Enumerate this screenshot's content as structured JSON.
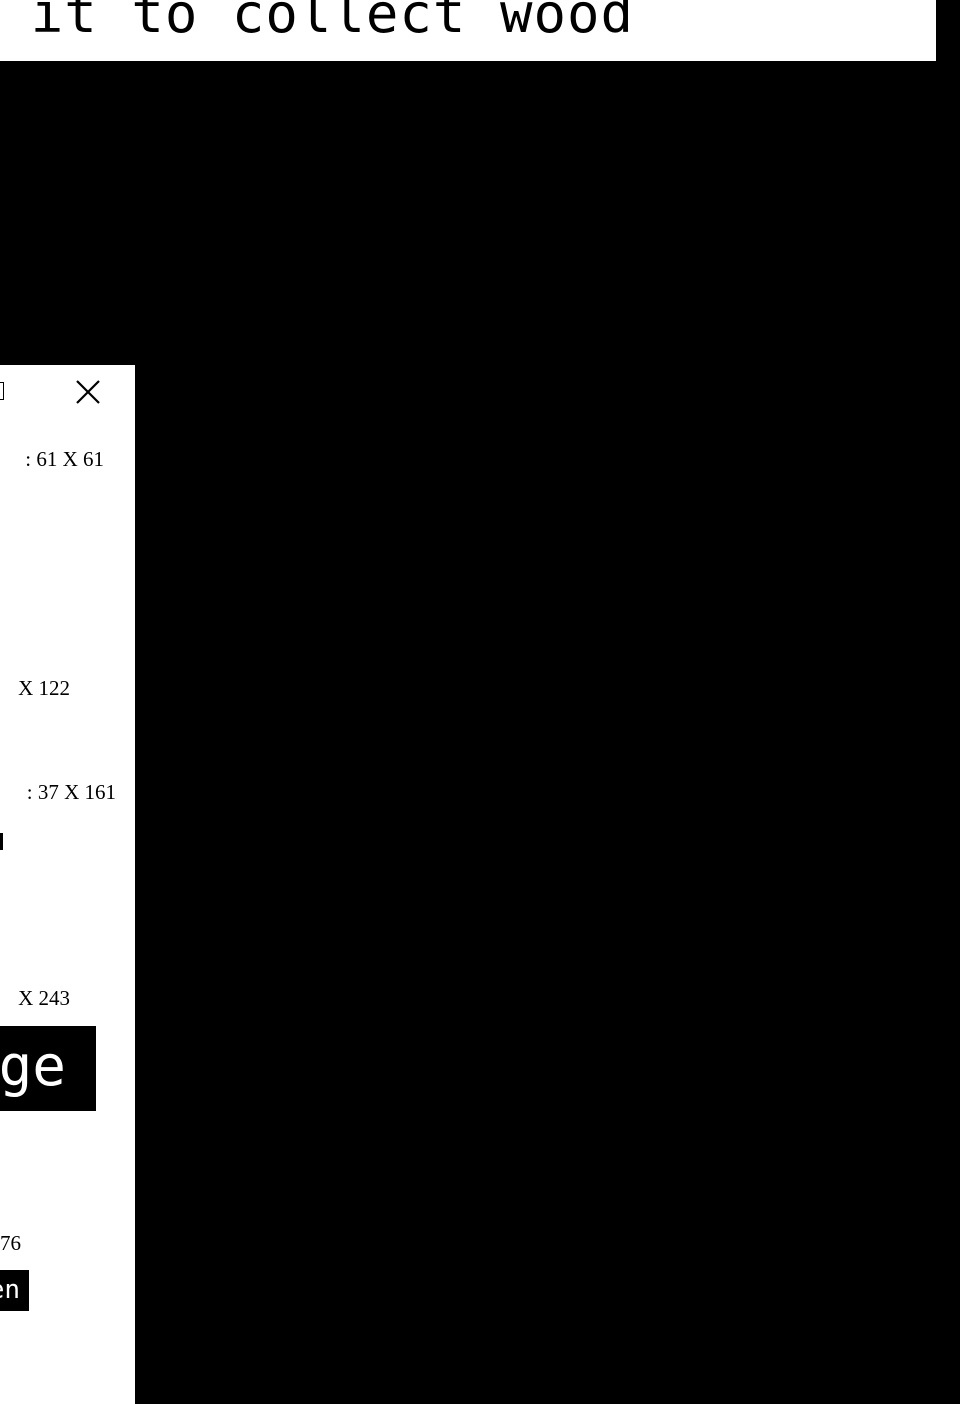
{
  "banner": {
    "text": "ach it to collect wood"
  },
  "panel": {
    "dimensions": [
      ": 61 X 61",
      "X 122",
      ": 37 X 161",
      "X 243",
      "76"
    ],
    "preview_text": "ge",
    "button_label": "en"
  },
  "icons": {
    "close": "close-icon",
    "edge_mark": "edge-mark-icon"
  },
  "colors": {
    "background": "#000000",
    "panel": "#ffffff",
    "text": "#000000",
    "inverse_text": "#ffffff"
  }
}
